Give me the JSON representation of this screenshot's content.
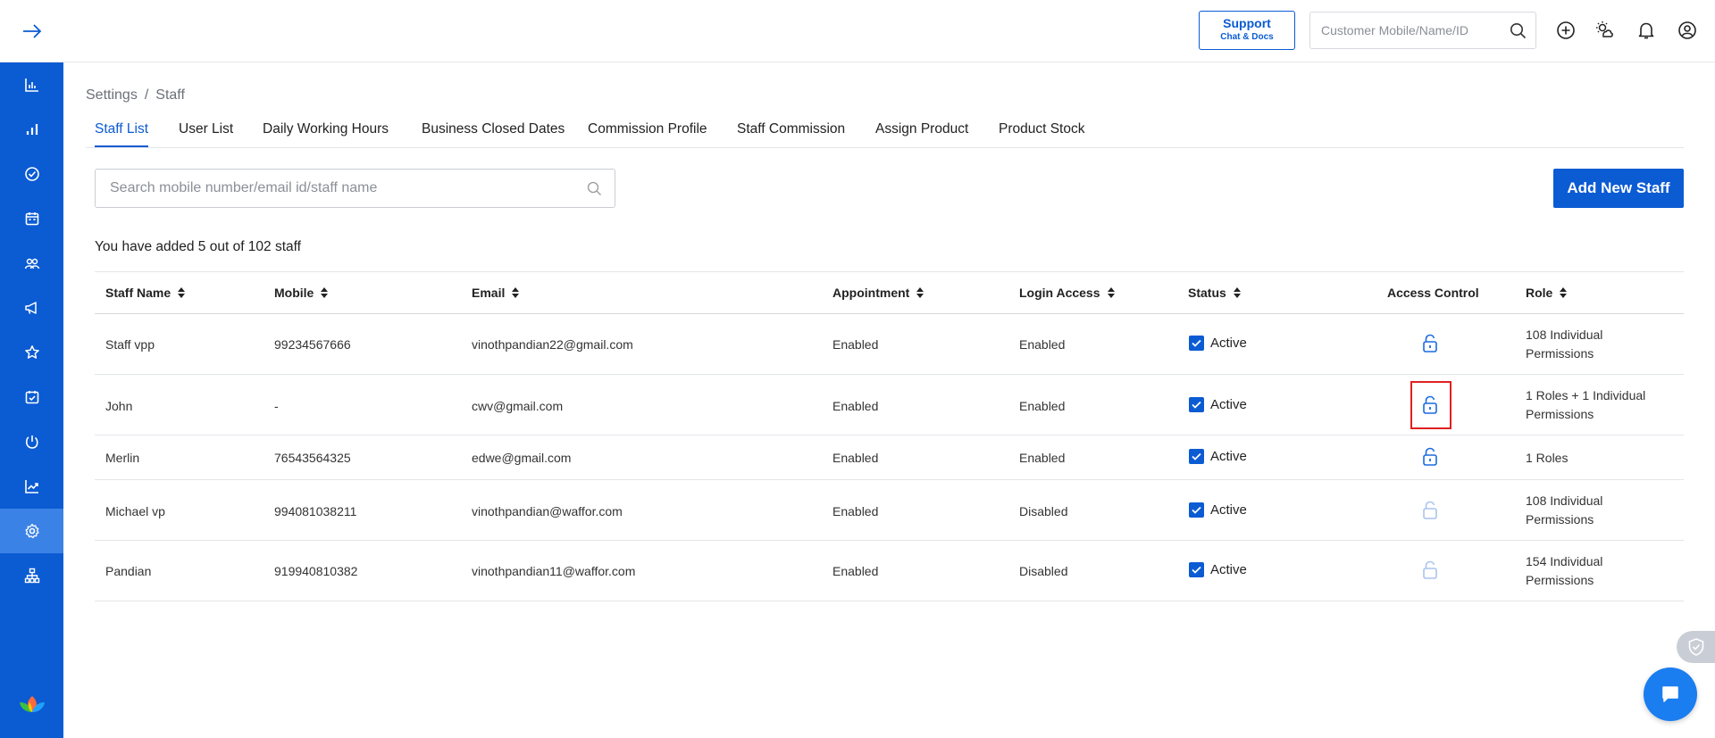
{
  "topbar": {
    "support_label": "Support",
    "support_sub": "Chat & Docs",
    "search_placeholder": "Customer Mobile/Name/ID",
    "icons": [
      "plus-circle-icon",
      "weather-icon",
      "bell-icon",
      "user-icon"
    ]
  },
  "sidebar": {
    "items": [
      {
        "icon": "bar-chart-icon"
      },
      {
        "icon": "signal-icon"
      },
      {
        "icon": "check-circle-icon"
      },
      {
        "icon": "calendar-icon"
      },
      {
        "icon": "people-icon"
      },
      {
        "icon": "megaphone-icon"
      },
      {
        "icon": "star-icon"
      },
      {
        "icon": "calendar-check-icon"
      },
      {
        "icon": "hand-icon"
      },
      {
        "icon": "trend-icon"
      },
      {
        "icon": "settings-icon",
        "active": true
      },
      {
        "icon": "org-chart-icon"
      }
    ]
  },
  "breadcrumb": {
    "parent": "Settings",
    "separator": "/",
    "current": "Staff"
  },
  "tabs": [
    {
      "label": "Staff List",
      "active": true
    },
    {
      "label": "User List"
    },
    {
      "label": "Daily Working Hours"
    },
    {
      "label": "Business Closed Dates"
    },
    {
      "label": "Commission Profile"
    },
    {
      "label": "Staff Commission"
    },
    {
      "label": "Assign Product"
    },
    {
      "label": "Product Stock"
    }
  ],
  "staff_search": {
    "placeholder": "Search mobile number/email id/staff name"
  },
  "add_button": "Add New Staff",
  "count_text": "You have added 5 out of 102 staff",
  "table": {
    "headers": {
      "name": "Staff Name",
      "mobile": "Mobile",
      "email": "Email",
      "appointment": "Appointment",
      "login": "Login Access",
      "status": "Status",
      "access": "Access Control",
      "role": "Role"
    },
    "rows": [
      {
        "name": "Staff vpp",
        "mobile": "99234567666",
        "email": "vinothpandian22@gmail.com",
        "appointment": "Enabled",
        "login": "Enabled",
        "status": "Active",
        "lock_enabled": true,
        "role": "108 Individual Permissions"
      },
      {
        "name": "John",
        "mobile": "-",
        "email": "cwv@gmail.com",
        "appointment": "Enabled",
        "login": "Enabled",
        "status": "Active",
        "lock_enabled": true,
        "highlighted": true,
        "role": "1 Roles + 1 Individual Permissions"
      },
      {
        "name": "Merlin",
        "mobile": "76543564325",
        "email": "edwe@gmail.com",
        "appointment": "Enabled",
        "login": "Enabled",
        "status": "Active",
        "lock_enabled": true,
        "role": "1 Roles"
      },
      {
        "name": "Michael vp",
        "mobile": "994081038211",
        "email": "vinothpandian@waffor.com",
        "appointment": "Enabled",
        "login": "Disabled",
        "status": "Active",
        "lock_enabled": false,
        "role": "108 Individual Permissions"
      },
      {
        "name": "Pandian",
        "mobile": "919940810382",
        "email": "vinothpandian11@waffor.com",
        "appointment": "Enabled",
        "login": "Disabled",
        "status": "Active",
        "lock_enabled": false,
        "role": "154 Individual Permissions"
      }
    ]
  },
  "colors": {
    "primary": "#0b5bd3",
    "lock_enabled": "#1a6ae0",
    "lock_disabled": "#a9c4ee",
    "highlight": "#e02020"
  }
}
